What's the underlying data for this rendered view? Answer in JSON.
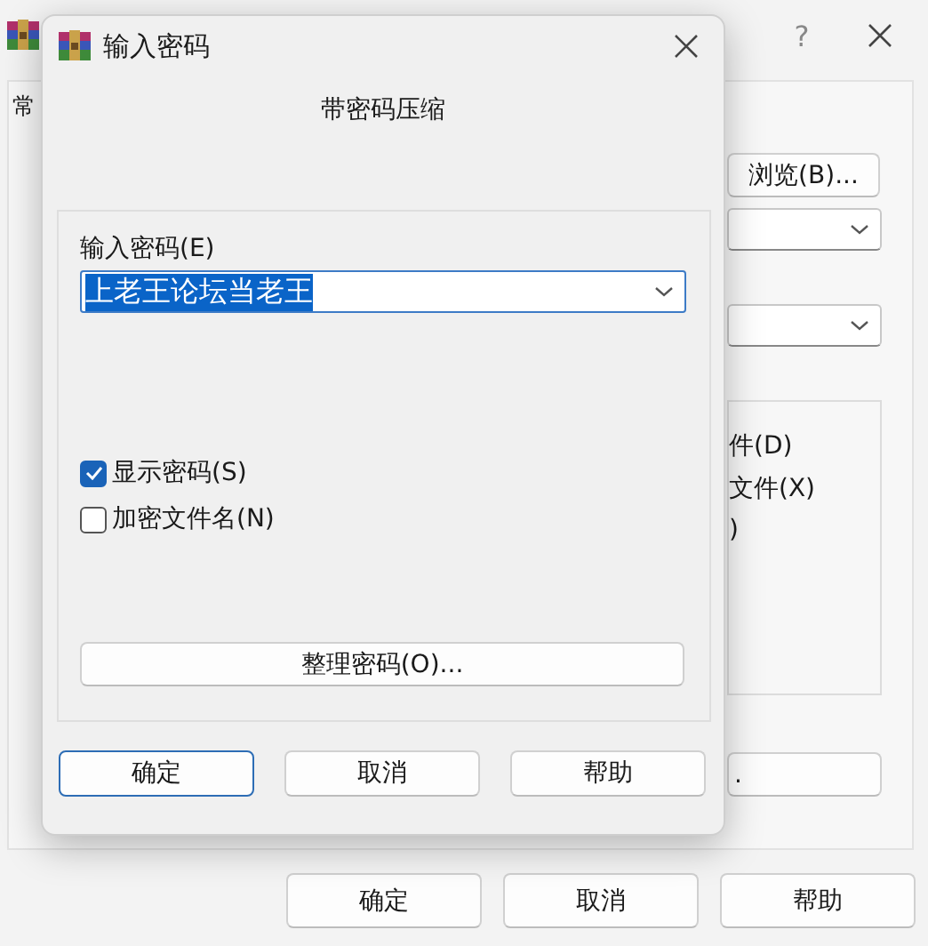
{
  "background_window": {
    "help_glyph": "?",
    "tab": "常",
    "browse_button": "浏览(B)...",
    "options": [
      {
        "label": "件(D)"
      },
      {
        "label": "文件(X)"
      },
      {
        "label": ")"
      }
    ],
    "side_button": ".",
    "buttons": [
      {
        "label": "确定",
        "default": false
      },
      {
        "label": "取消",
        "default": false
      },
      {
        "label": "帮助",
        "default": false
      }
    ]
  },
  "dialog": {
    "title": "输入密码",
    "heading": "带密码压缩",
    "password_label": "输入密码(E)",
    "password": {
      "value": "上老王论坛当老王",
      "text_selected": true
    },
    "checkboxes": [
      {
        "label": "显示密码(S)",
        "checked": true
      },
      {
        "label": "加密文件名(N)",
        "checked": false
      }
    ],
    "organize_button": "整理密码(O)...",
    "buttons": [
      {
        "label": "确定",
        "default": true
      },
      {
        "label": "取消",
        "default": false
      },
      {
        "label": "帮助",
        "default": false
      }
    ]
  }
}
